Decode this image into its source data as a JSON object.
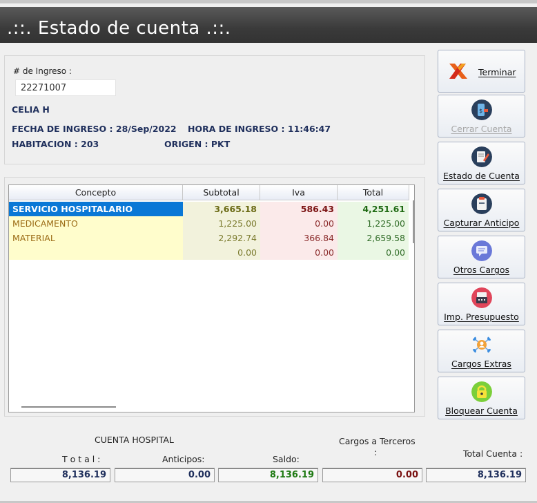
{
  "window": {
    "title": ".::. Estado de cuenta .::."
  },
  "patient": {
    "ingreso_label": "# de Ingreso :",
    "ingreso_value": "22271007",
    "name": "CELIA H",
    "fecha_ingreso": "FECHA DE INGRESO : 28/Sep/2022",
    "hora_ingreso": "HORA DE INGRESO : 11:46:47",
    "habitacion": "HABITACION : 203",
    "origen": "ORIGEN : PKT"
  },
  "grid": {
    "headers": [
      "Concepto",
      "Subtotal",
      "Iva",
      "Total"
    ],
    "rows": [
      {
        "concepto": "SERVICIO HOSPITALARIO",
        "subtotal": "3,665.18",
        "iva": "586.43",
        "total": "4,251.61"
      },
      {
        "concepto": "MEDICAMENTO",
        "subtotal": "1,225.00",
        "iva": "0.00",
        "total": "1,225.00"
      },
      {
        "concepto": "MATERIAL",
        "subtotal": "2,292.74",
        "iva": "366.84",
        "total": "2,659.58"
      },
      {
        "concepto": "",
        "subtotal": "0.00",
        "iva": "0.00",
        "total": "0.00"
      }
    ]
  },
  "buttons": [
    {
      "label": "Terminar",
      "icon": "x-close-icon",
      "enabled": true
    },
    {
      "label": "Cerrar Cuenta",
      "icon": "phone-payment-icon",
      "enabled": false
    },
    {
      "label": "Estado de Cuenta",
      "icon": "document-edit-icon",
      "enabled": true
    },
    {
      "label": "Capturar Anticipo",
      "icon": "clipboard-icon",
      "enabled": true
    },
    {
      "label": "Otros Cargos",
      "icon": "chat-bubble-icon",
      "enabled": true
    },
    {
      "label": "Imp. Presupuesto",
      "icon": "fax-printer-icon",
      "enabled": true
    },
    {
      "label": "Cargos Extras",
      "icon": "network-user-icon",
      "enabled": true
    },
    {
      "label": "Bloquear Cuenta",
      "icon": "padlock-icon",
      "enabled": true
    }
  ],
  "summary": {
    "section_label": "CUENTA HOSPITAL",
    "total_label": "T o t a l :",
    "anticipos_label": "Anticipos:",
    "saldo_label": "Saldo:",
    "terceros_label": "Cargos a Terceros",
    "terceros_colon": ":",
    "total_cuenta_label": "Total Cuenta :",
    "total_value": "8,136.19",
    "anticipos_value": "0.00",
    "saldo_value": "8,136.19",
    "terceros_value": "0.00",
    "total_cuenta_value": "8,136.19"
  },
  "colors": {
    "navy": "#1f2f5c",
    "selection": "#0a78d6",
    "green": "#1f7a13",
    "maroon": "#7a1111"
  }
}
